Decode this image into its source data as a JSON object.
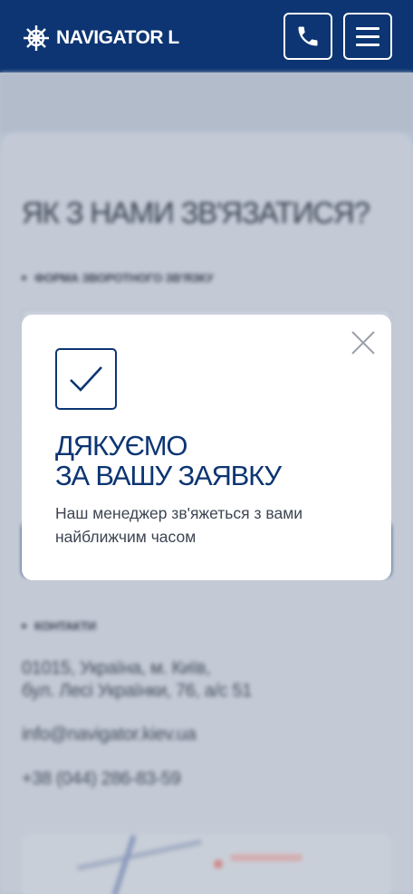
{
  "header": {
    "logo_text": "NAVIGATOR L",
    "logo_icon": "ship-wheel-icon",
    "phone_icon": "phone-icon",
    "menu_icon": "hamburger-menu-icon",
    "background_color": "#0d3573"
  },
  "background_page": {
    "title": "ЯК З НАМИ ЗВ'ЯЗАТИСЯ?",
    "form_section_label": "ФОРМА ЗВОРОТНОГО ЗВ'ЯЗКУ",
    "contacts_section_label": "КОНТАКТИ",
    "address_line1": "01015, Україна, м. Київ,",
    "address_line2": "бул. Лесі Українки, 76, а/с 51",
    "email": "info@navigator.kiev.ua",
    "phone": "+38 (044) 286-83-59"
  },
  "modal": {
    "check_icon": "checkmark-icon",
    "close_icon": "close-icon",
    "title_line1": "ДЯКУЄМО",
    "title_line2": "ЗА ВАШУ ЗАЯВКУ",
    "message": "Наш менеджер зв'яжеться з вами найближчим часом",
    "accent_color": "#0d3573"
  }
}
